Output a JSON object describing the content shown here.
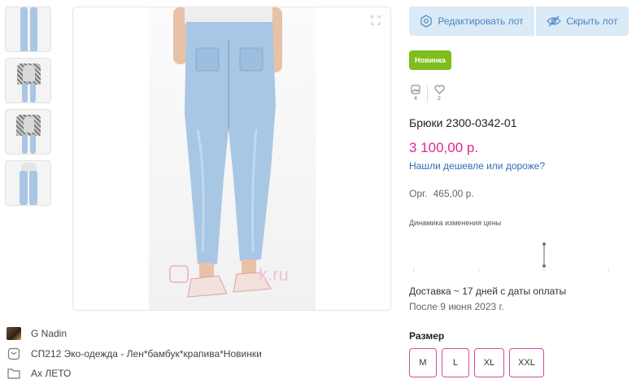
{
  "gallery": {
    "watermark": "k.ru",
    "thumbnails": [
      "thumb-1",
      "thumb-2",
      "thumb-3",
      "thumb-4"
    ]
  },
  "meta": {
    "seller": "G Nadin",
    "catalog": "СП212 Эко-одежда - Лен*бамбук*крапива*Новинки",
    "folder": "Ах ЛЕТО"
  },
  "actions": {
    "edit_label": "Редактировать лот",
    "hide_label": "Скрыть лот"
  },
  "badge": "Новинка",
  "counters": {
    "photos": "4",
    "likes": "2"
  },
  "product": {
    "title": "Брюки 2300-0342-01",
    "price": "3 100,00 р.",
    "cheaper_link": "Нашли дешевле или дороже?",
    "org_label": "Орг.",
    "org_value": "465,00 р."
  },
  "price_dynamics": {
    "title": "Динамика изменения цены"
  },
  "delivery": {
    "text": "Доставка ~ 17 дней с даты оплаты",
    "after": "После 9 июня 2023 г."
  },
  "sizes": {
    "label": "Размер",
    "options": [
      "M",
      "L",
      "XL",
      "XXL"
    ]
  },
  "colors": {
    "accent_blue": "#4a86bf",
    "price_pink": "#e4278f",
    "badge_green": "#7fbc1d",
    "size_border": "#d24c9c"
  }
}
